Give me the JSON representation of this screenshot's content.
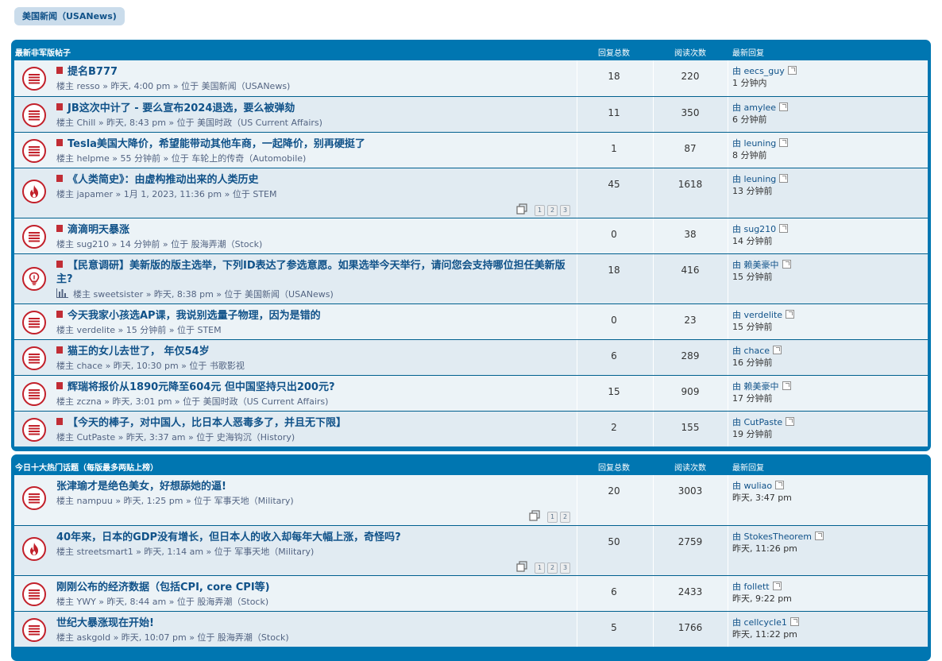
{
  "breadcrumb": "美国新闻（USANews)",
  "section1": {
    "title": "最新非军版帖子",
    "col_replies": "回复总数",
    "col_views": "阅读次数",
    "col_last": "最新回复",
    "rows": [
      {
        "icon": "topic",
        "title": "提名B777",
        "byline": "楼主 resso » 昨天, 4:00 pm » 位于 美国新闻（USANews)",
        "replies": "18",
        "views": "220",
        "last_by": "由 eecs_guy",
        "last_time": "1 分钟内"
      },
      {
        "icon": "topic",
        "title": "JB这次中计了 - 要么宣布2024退选，要么被弹劾",
        "byline": "楼主 Chill » 昨天, 8:43 pm » 位于 美国时政（US Current Affairs)",
        "replies": "11",
        "views": "350",
        "last_by": "由 amylee",
        "last_time": "6 分钟前"
      },
      {
        "icon": "topic",
        "title": "Tesla美国大降价，希望能带动其他车商，一起降价，别再硬挺了",
        "byline": "楼主 helpme » 55 分钟前 » 位于 车轮上的传奇（Automobile)",
        "replies": "1",
        "views": "87",
        "last_by": "由 leuning",
        "last_time": "8 分钟前"
      },
      {
        "icon": "hot",
        "title": "《人类简史》：由虚构推动出来的人类历史",
        "byline": "楼主 japamer » 1月 1, 2023, 11:36 pm » 位于 STEM",
        "replies": "45",
        "views": "1618",
        "last_by": "由 leuning",
        "last_time": "13 分钟前",
        "pages": [
          "1",
          "2",
          "3"
        ]
      },
      {
        "icon": "topic",
        "title": "滴滴明天暴涨",
        "byline": "楼主 sug210 » 14 分钟前 » 位于 股海弄潮（Stock)",
        "replies": "0",
        "views": "38",
        "last_by": "由 sug210",
        "last_time": "14 分钟前"
      },
      {
        "icon": "idea",
        "title": "【民意调研】美新版的版主选举，下列ID表达了参选意愿。如果选举今天举行，请问您会支持哪位担任美新版主?",
        "byline": "楼主 sweetsister » 昨天, 8:38 pm » 位于 美国新闻（USANews)",
        "replies": "18",
        "views": "416",
        "last_by": "由 赖美豪中",
        "last_time": "15 分钟前",
        "poll": true
      },
      {
        "icon": "topic",
        "title": "今天我家小孩选AP课，我说别选量子物理，因为是错的",
        "byline": "楼主 verdelite » 15 分钟前 » 位于 STEM",
        "replies": "0",
        "views": "23",
        "last_by": "由 verdelite",
        "last_time": "15 分钟前"
      },
      {
        "icon": "topic",
        "title": "猫王的女儿去世了， 年仅54岁",
        "byline": "楼主 chace » 昨天, 10:30 pm » 位于 书歌影视",
        "replies": "6",
        "views": "289",
        "last_by": "由 chace",
        "last_time": "16 分钟前"
      },
      {
        "icon": "topic",
        "title": "辉瑞将报价从1890元降至604元 但中国坚持只出200元?",
        "byline": "楼主 zczna » 昨天, 3:01 pm » 位于 美国时政（US Current Affairs)",
        "replies": "15",
        "views": "909",
        "last_by": "由 赖美豪中",
        "last_time": "17 分钟前"
      },
      {
        "icon": "topic",
        "title": "【今天的棒子，对中国人，比日本人恶毒多了，并且无下限】",
        "byline": "楼主 CutPaste » 昨天, 3:37 am » 位于 史海钩沉（History)",
        "replies": "2",
        "views": "155",
        "last_by": "由 CutPaste",
        "last_time": "19 分钟前"
      }
    ]
  },
  "section2": {
    "title": "今日十大热门话题（每版最多两贴上榜）",
    "col_replies": "回复总数",
    "col_views": "阅读次数",
    "col_last": "最新回复",
    "rows": [
      {
        "icon": "topic",
        "title": "张津瑜才是绝色美女，好想舔她的逼!",
        "byline": "楼主 nampuu » 昨天, 1:25 pm » 位于 军事天地（Military)",
        "replies": "20",
        "views": "3003",
        "last_by": "由 wuliao",
        "last_time": "昨天, 3:47 pm",
        "pages": [
          "1",
          "2"
        ]
      },
      {
        "icon": "hot",
        "title": "40年来，日本的GDP没有增长，但日本人的收入却每年大幅上涨，奇怪吗?",
        "byline": "楼主 streetsmart1 » 昨天, 1:14 am » 位于 军事天地（Military)",
        "replies": "50",
        "views": "2759",
        "last_by": "由 StokesTheorem",
        "last_time": "昨天, 11:26 pm",
        "pages": [
          "1",
          "2",
          "3"
        ]
      },
      {
        "icon": "topic",
        "title": "刚刚公布的经济数据（包括CPI, core CPI等)",
        "byline": "楼主 YWY » 昨天, 8:44 am » 位于 股海弄潮（Stock)",
        "replies": "6",
        "views": "2433",
        "last_by": "由 follett",
        "last_time": "昨天, 9:22 pm"
      },
      {
        "icon": "topic",
        "title": "世纪大暴涨现在开始!",
        "byline": "楼主 askgold » 昨天, 10:07 pm » 位于 股海弄潮（Stock)",
        "replies": "5",
        "views": "1766",
        "last_by": "由 cellcycle1",
        "last_time": "昨天, 11:22 pm"
      }
    ]
  }
}
